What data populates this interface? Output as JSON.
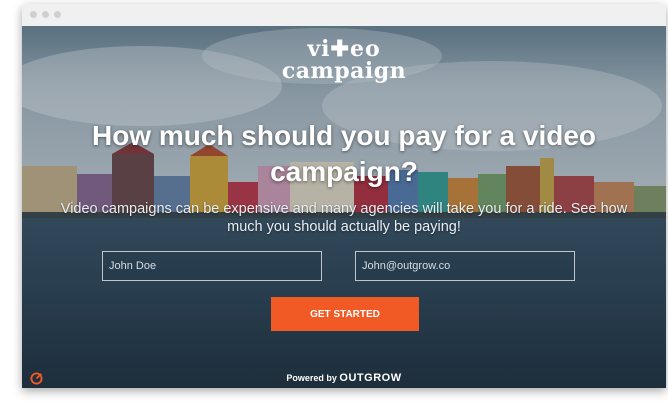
{
  "logo": {
    "line1": "vi✚eo",
    "line2": "campaign"
  },
  "hero": {
    "headline": "How much should you pay for a video campaign?",
    "subtitle": "Video campaigns can be expensive and many agencies will take you for a ride. See how much you should actually be paying!"
  },
  "form": {
    "name_placeholder": "John Doe",
    "email_placeholder": "John@outgrow.co",
    "cta_label": "GET STARTED"
  },
  "footer": {
    "powered_by": "Powered by",
    "brand": "OUTGROW"
  },
  "colors": {
    "accent": "#f15a24",
    "text": "#ffffff"
  }
}
